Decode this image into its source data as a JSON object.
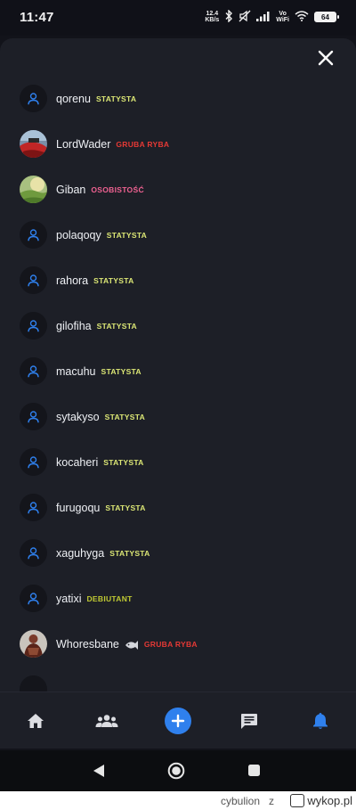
{
  "status_bar": {
    "time": "11:47",
    "speed_value": "12.4",
    "speed_unit": "KB/s",
    "vo_top": "Vo",
    "vo_bottom": "WiFi",
    "battery": "64"
  },
  "sheet": {
    "close_icon": "close-icon"
  },
  "users": [
    {
      "name": "qorenu",
      "rank": "STATYSTA",
      "rank_color": "#dce775",
      "avatar": "default"
    },
    {
      "name": "LordWader",
      "rank": "GRUBA RYBA",
      "rank_color": "#e53935",
      "avatar": "photo-red"
    },
    {
      "name": "Giban",
      "rank": "OSOBISTOŚĆ",
      "rank_color": "#f06292",
      "avatar": "photo-green"
    },
    {
      "name": "polaqoqy",
      "rank": "STATYSTA",
      "rank_color": "#dce775",
      "avatar": "default"
    },
    {
      "name": "rahora",
      "rank": "STATYSTA",
      "rank_color": "#dce775",
      "avatar": "default"
    },
    {
      "name": "gilofiha",
      "rank": "STATYSTA",
      "rank_color": "#dce775",
      "avatar": "default"
    },
    {
      "name": "macuhu",
      "rank": "STATYSTA",
      "rank_color": "#dce775",
      "avatar": "default"
    },
    {
      "name": "sytakyso",
      "rank": "STATYSTA",
      "rank_color": "#dce775",
      "avatar": "default"
    },
    {
      "name": "kocaheri",
      "rank": "STATYSTA",
      "rank_color": "#dce775",
      "avatar": "default"
    },
    {
      "name": "furugoqu",
      "rank": "STATYSTA",
      "rank_color": "#dce775",
      "avatar": "default"
    },
    {
      "name": "xaguhyga",
      "rank": "STATYSTA",
      "rank_color": "#dce775",
      "avatar": "default"
    },
    {
      "name": "yatixi",
      "rank": "DEBIUTANT",
      "rank_color": "#c0ca33",
      "avatar": "default"
    },
    {
      "name": "Whoresbane",
      "rank": "GRUBA RYBA",
      "rank_color": "#e53935",
      "avatar": "photo-figure"
    }
  ],
  "bottom_nav": {
    "items": [
      "home-icon",
      "people-icon",
      "add-icon",
      "messages-icon",
      "notifications-icon"
    ],
    "active": "notifications-icon",
    "accent": "#2f80ed"
  },
  "system_nav": [
    "back-icon",
    "home-circle-icon",
    "recents-icon"
  ],
  "watermark": {
    "user": "cybulion",
    "z": "z",
    "site": "wykop.pl"
  },
  "colors": {
    "background": "#1d1f27",
    "avatar_icon": "#2f80ed"
  }
}
